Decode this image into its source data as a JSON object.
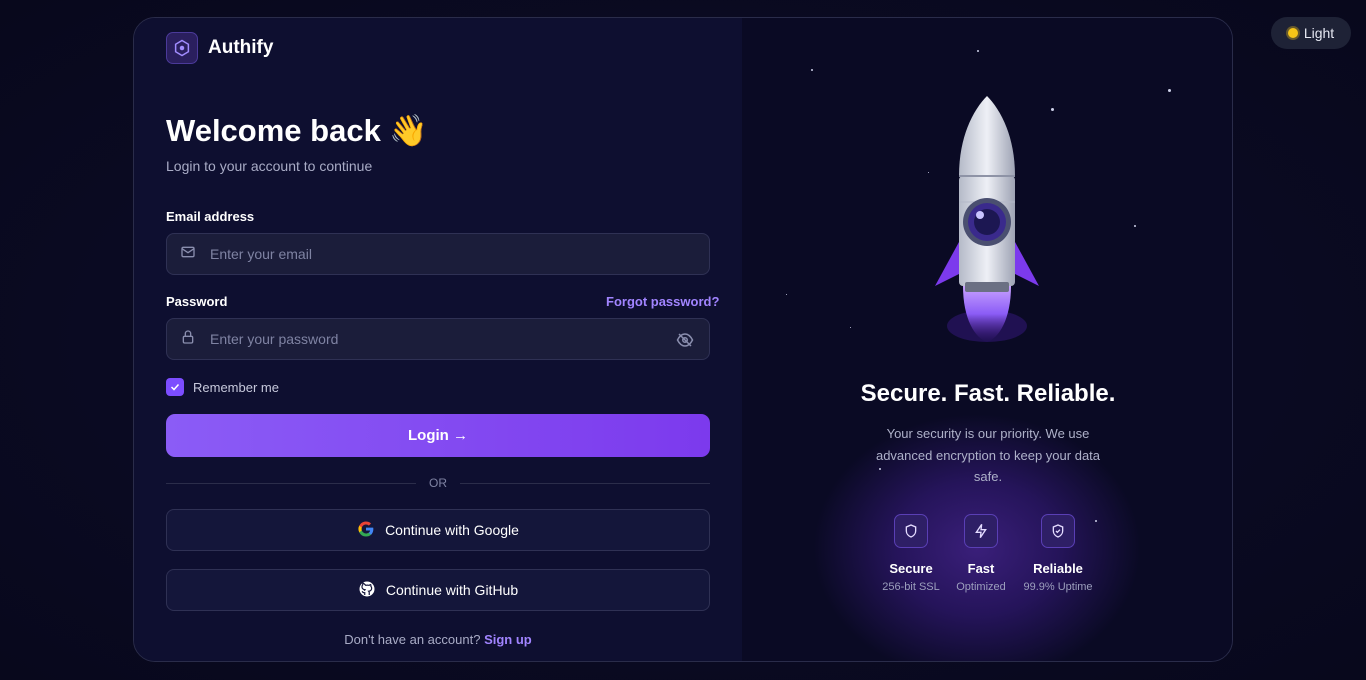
{
  "theme_toggle": {
    "label": "Light",
    "icon": "sun-icon"
  },
  "brand": {
    "name": "Authify",
    "icon": "hexagon-logo-icon"
  },
  "login": {
    "title": "Welcome back 👋",
    "subtitle": "Login to your account to continue",
    "email_label": "Email address",
    "email_placeholder": "Enter your email",
    "email_value": "",
    "password_label": "Password",
    "forgot_label": "Forgot password?",
    "password_placeholder": "Enter your password",
    "password_value": "",
    "remember_label": "Remember me",
    "remember_checked": true,
    "login_button": "Login →",
    "divider_text": "OR",
    "google_button": "Continue with Google",
    "github_button": "Continue with GitHub",
    "signup_prompt": "Don't have an account?",
    "signup_link": "Sign up"
  },
  "hero": {
    "headline": "Secure. Fast. Reliable.",
    "description": "Your security is our priority. We use advanced encryption to keep your data safe.",
    "features": [
      {
        "title": "Secure",
        "subtitle": "256-bit SSL",
        "icon": "shield-icon"
      },
      {
        "title": "Fast",
        "subtitle": "Optimized",
        "icon": "lightning-icon"
      },
      {
        "title": "Reliable",
        "subtitle": "99.9% Uptime",
        "icon": "shield-check-icon"
      }
    ]
  },
  "colors": {
    "accent": "#7c3aed",
    "link": "#a184ff",
    "background": "#0a0a22"
  }
}
